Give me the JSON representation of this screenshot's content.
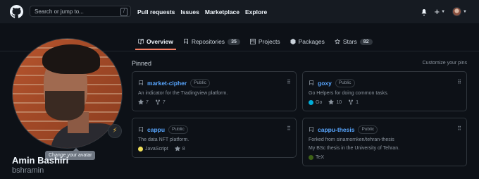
{
  "header": {
    "search_placeholder": "Search or jump to...",
    "search_shortcut": "/",
    "nav": [
      "Pull requests",
      "Issues",
      "Marketplace",
      "Explore"
    ],
    "plus_label": "+",
    "icons": [
      "github-logo-icon",
      "bell-icon",
      "plus-icon",
      "chevron-down-icon"
    ]
  },
  "tabs": [
    {
      "label": "Overview",
      "icon": "book-icon",
      "active": true
    },
    {
      "label": "Repositories",
      "icon": "repo-icon",
      "count": "35"
    },
    {
      "label": "Projects",
      "icon": "project-icon"
    },
    {
      "label": "Packages",
      "icon": "package-icon"
    },
    {
      "label": "Stars",
      "icon": "star-icon",
      "count": "82"
    }
  ],
  "profile": {
    "name": "Amin Bashiri",
    "username": "bshramin",
    "tooltip": "Change your avatar",
    "status_icon": "zap-icon"
  },
  "pinned": {
    "title": "Pinned",
    "customize": "Customize your pins",
    "cards": [
      {
        "name": "market-cipher",
        "visibility": "Public",
        "description": "An indicator for the Tradingview platform.",
        "stars": "7",
        "forks": "7"
      },
      {
        "name": "goxy",
        "visibility": "Public",
        "description": "Go Helpers for doing common tasks.",
        "language": "Go",
        "lang_color": "#00add8",
        "stars": "10",
        "forks": "1"
      },
      {
        "name": "cappu",
        "visibility": "Public",
        "description": "The data NFT platform.",
        "language": "JavaScript",
        "lang_color": "#f1e05a",
        "stars": "8"
      },
      {
        "name": "cappu-thesis",
        "visibility": "Public",
        "forked_from": "Forked from sinamomken/tehran-thesis",
        "description": "My BSc thesis in the University of Tehran.",
        "language": "TeX",
        "lang_color": "#3d6117"
      }
    ]
  }
}
